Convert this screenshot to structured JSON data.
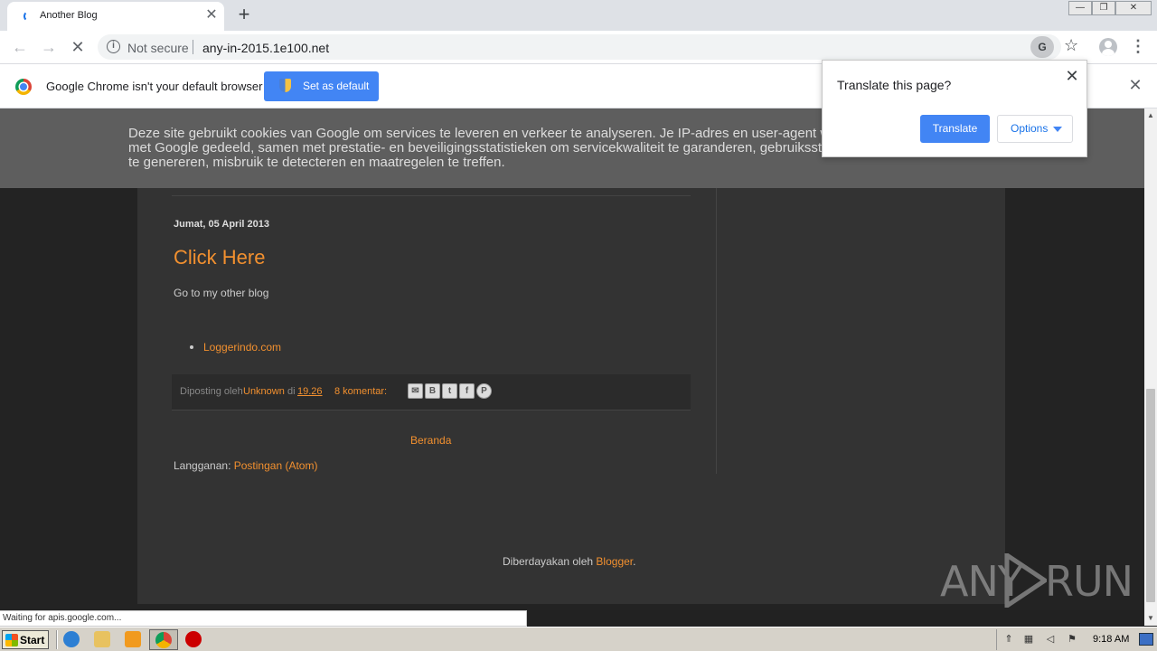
{
  "browser": {
    "tab_title": "Another Blog",
    "new_tab_icon": "+",
    "security_label": "Not secure",
    "url": "any-in-2015.1e100.net"
  },
  "infobar": {
    "message": "Google Chrome isn't your default browser",
    "button_label": "Set as default"
  },
  "translate_popup": {
    "title": "Translate this page?",
    "translate_label": "Translate",
    "options_label": "Options"
  },
  "cookie_banner": {
    "text": "Deze site gebruikt cookies van Google om services te leveren en verkeer te analyseren. Je IP-adres en user-agent worden met Google gedeeld, samen met prestatie- en beveiligingsstatistieken om servicekwaliteit te garanderen, gebruiksstatistieken te genereren, misbruik te detecteren en maatregelen te treffen."
  },
  "post": {
    "date": "Jumat, 05 April 2013",
    "title": "Click Here",
    "body": "Go to my other blog",
    "link": "Loggerindo.com",
    "footer": {
      "posted_by": "Diposting oleh",
      "author": "Unknown",
      "at": "di",
      "time": "19.26",
      "comments": "8 komentar:"
    }
  },
  "page": {
    "home_link": "Beranda",
    "subscribe_label": "Langganan:",
    "subscribe_link": "Postingan (Atom)",
    "powered_by": "Diberdayakan oleh",
    "powered_link": "Blogger"
  },
  "status_text": "Waiting for apis.google.com...",
  "watermark": {
    "left": "ANY",
    "right": "RUN"
  },
  "taskbar": {
    "start_label": "Start",
    "clock": "9:18 AM"
  },
  "colors": {
    "accent_link": "#f2902f",
    "chrome_blue": "#4285f4"
  }
}
